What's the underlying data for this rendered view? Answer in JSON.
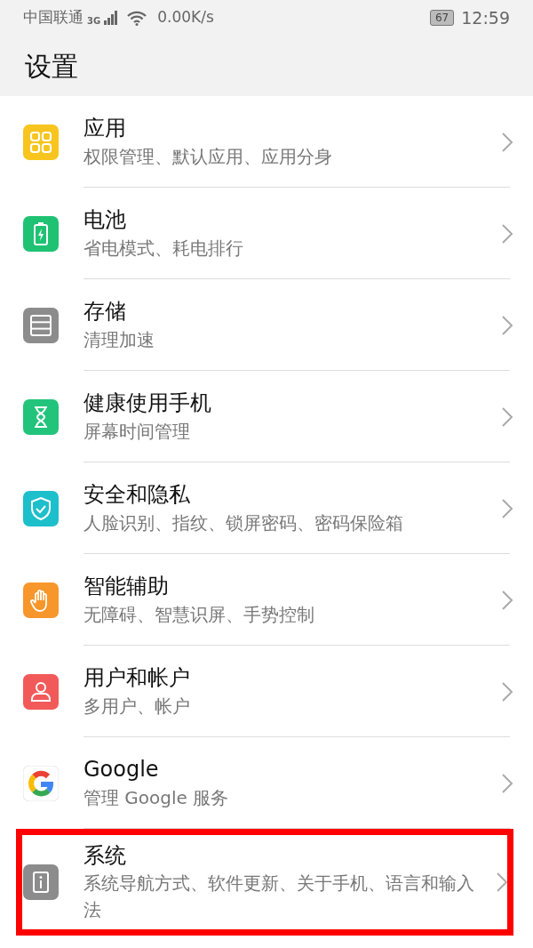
{
  "status_bar": {
    "carrier": "中国联通",
    "network": "3G",
    "speed": "0.00K/s",
    "battery": "67",
    "time": "12:59"
  },
  "title": "设置",
  "items": [
    {
      "kind": "apps",
      "color": "#f7c51e",
      "title": "应用",
      "subtitle": "权限管理、默认应用、应用分身",
      "highlighted": false
    },
    {
      "kind": "battery",
      "color": "#1fc273",
      "title": "电池",
      "subtitle": "省电模式、耗电排行",
      "highlighted": false
    },
    {
      "kind": "storage",
      "color": "#8c8c8c",
      "title": "存储",
      "subtitle": "清理加速",
      "highlighted": false
    },
    {
      "kind": "hourglass",
      "color": "#22c47c",
      "title": "健康使用手机",
      "subtitle": "屏幕时间管理",
      "highlighted": false
    },
    {
      "kind": "shield",
      "color": "#1dbfcb",
      "title": "安全和隐私",
      "subtitle": "人脸识别、指纹、锁屏密码、密码保险箱",
      "highlighted": false
    },
    {
      "kind": "hand",
      "color": "#f7962b",
      "title": "智能辅助",
      "subtitle": "无障碍、智慧识屏、手势控制",
      "highlighted": false
    },
    {
      "kind": "user",
      "color": "#f25a5a",
      "title": "用户和帐户",
      "subtitle": "多用户、帐户",
      "highlighted": false
    },
    {
      "kind": "google",
      "title": "Google",
      "subtitle": "管理 Google 服务",
      "highlighted": false
    },
    {
      "kind": "info",
      "color": "#8c8c8c",
      "title": "系统",
      "subtitle": "系统导航方式、软件更新、关于手机、语言和输入法",
      "highlighted": true
    }
  ]
}
